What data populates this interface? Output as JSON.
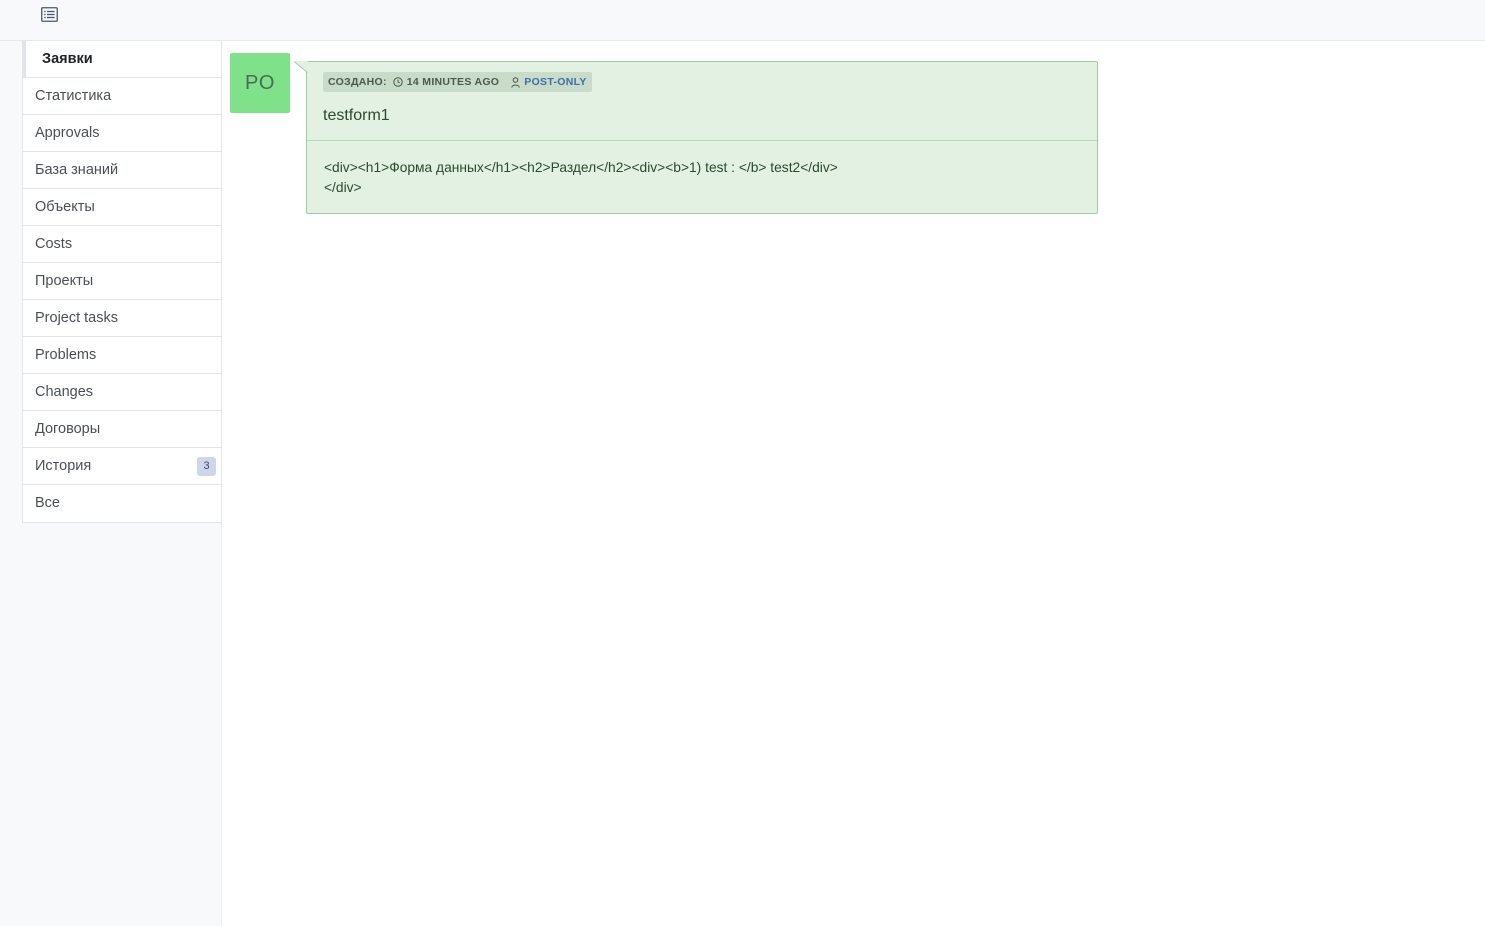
{
  "header": {
    "menu_icon": "list-icon"
  },
  "sidebar": {
    "items": [
      {
        "label": "Заявки",
        "active": true
      },
      {
        "label": "Статистика"
      },
      {
        "label": "Approvals"
      },
      {
        "label": "База знаний"
      },
      {
        "label": "Объекты"
      },
      {
        "label": "Costs"
      },
      {
        "label": "Проекты"
      },
      {
        "label": "Project tasks"
      },
      {
        "label": "Problems"
      },
      {
        "label": "Changes"
      },
      {
        "label": "Договоры"
      },
      {
        "label": "История",
        "badge": "3"
      },
      {
        "label": "Все"
      }
    ]
  },
  "post": {
    "avatar_initials": "PO",
    "created_label": "СОЗДАНО:",
    "time_ago": "14 MINUTES AGO",
    "author": "POST-ONLY",
    "title": "testform1",
    "body": "<div><h1>Форма данных</h1><h2>Раздел</h2><div><b>1) test : </b> test2</div></div>"
  },
  "colors": {
    "card_bg": "#e2f1e2",
    "card_border": "#9ccf9f",
    "avatar_bg": "#7fe28b",
    "author_link": "#3f6ea8",
    "badge_bg": "#cfd6ec"
  }
}
